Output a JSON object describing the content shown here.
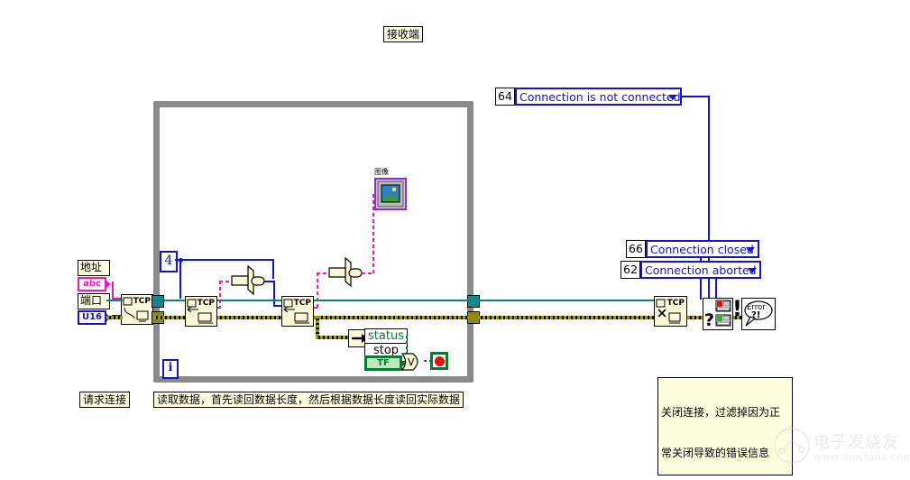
{
  "diagram": {
    "title": "接收端",
    "title_box_name": "diagram-title"
  },
  "colors": {
    "loop_border": "#8a8a8a",
    "blue_wire": "#1414c8",
    "pink_wire": "#e818c8",
    "teal_wire": "#0e8080",
    "error_wire": "#9a9a00",
    "green_wire": "#0a7a32",
    "comment_bg": "#fffde0",
    "vi_bg": "#fbf8d8",
    "stop_red": "#e01010",
    "image_border": "#8a2be2"
  },
  "controls": {
    "address_label": "地址",
    "address_terminal": "abc",
    "port_label": "端口",
    "port_terminal": "U16"
  },
  "constants": {
    "length_constant": "4",
    "iteration_terminal": "i"
  },
  "rings": [
    {
      "code": "64",
      "label": "Connection is not connected"
    },
    {
      "code": "66",
      "label": "Connection closed"
    },
    {
      "code": "62",
      "label": "Connection aborted"
    }
  ],
  "cluster": {
    "status_item": "status",
    "stop_item": "stop",
    "stop_terminal": "TF"
  },
  "nodes": {
    "tcp_open_caption": "TCP",
    "tcp_read1_caption": "TCP",
    "tcp_read2_caption": "TCP",
    "tcp_close_caption": "TCP",
    "error_handler_text": "Error",
    "error_handler_mark": "?!",
    "clear_errors_mark": "?"
  },
  "indicators": {
    "image_label": "图像"
  },
  "comments": [
    {
      "name": "comment-request-connection",
      "text": "请求连接"
    },
    {
      "name": "comment-read-data",
      "text": "读取数据，首先读回数据长度，然后根据数据长度读回实际数据"
    }
  ],
  "comment_close": {
    "line1": "关闭连接，过滤掉因为正",
    "line2": "常关闭导致的错误信息"
  },
  "watermark": {
    "text": "电子发烧友",
    "url": "www.elecfans.com"
  }
}
